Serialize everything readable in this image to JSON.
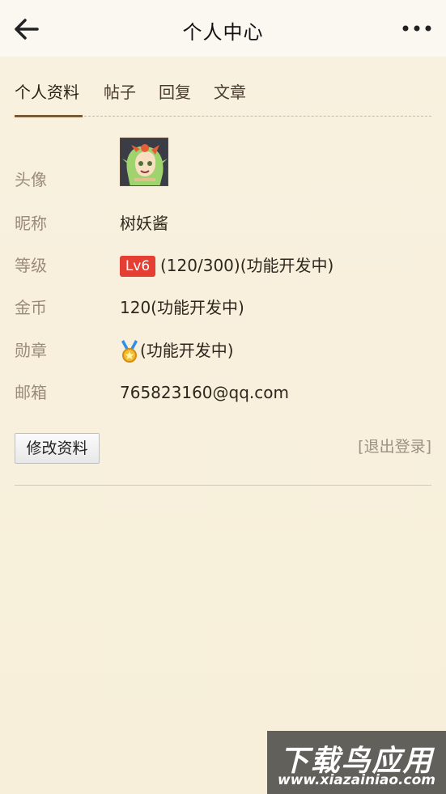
{
  "header": {
    "title": "个人中心",
    "back_icon": "back-arrow-icon",
    "more_icon": "more-horizontal-icon"
  },
  "tabs": [
    {
      "label": "个人资料",
      "active": true
    },
    {
      "label": "帖子",
      "active": false
    },
    {
      "label": "回复",
      "active": false
    },
    {
      "label": "文章",
      "active": false
    }
  ],
  "profile": {
    "avatar_label": "头像",
    "nickname_label": "昵称",
    "nickname": "树妖酱",
    "level_label": "等级",
    "level_badge": "Lv6",
    "level_progress": "(120/300)(功能开发中)",
    "coins_label": "金币",
    "coins": "120(功能开发中)",
    "medal_label": "勋章",
    "medal_text": "(功能开发中)",
    "email_label": "邮箱",
    "email": "765823160@qq.com"
  },
  "actions": {
    "edit_profile": "修改资料",
    "logout": "[退出登录]"
  },
  "watermark": {
    "title": "下载鸟应用",
    "url": "www.xiazainiao.com"
  },
  "colors": {
    "accent": "#7b5a38",
    "level_badge": "#e53e32",
    "background": "#f8f0dc"
  }
}
